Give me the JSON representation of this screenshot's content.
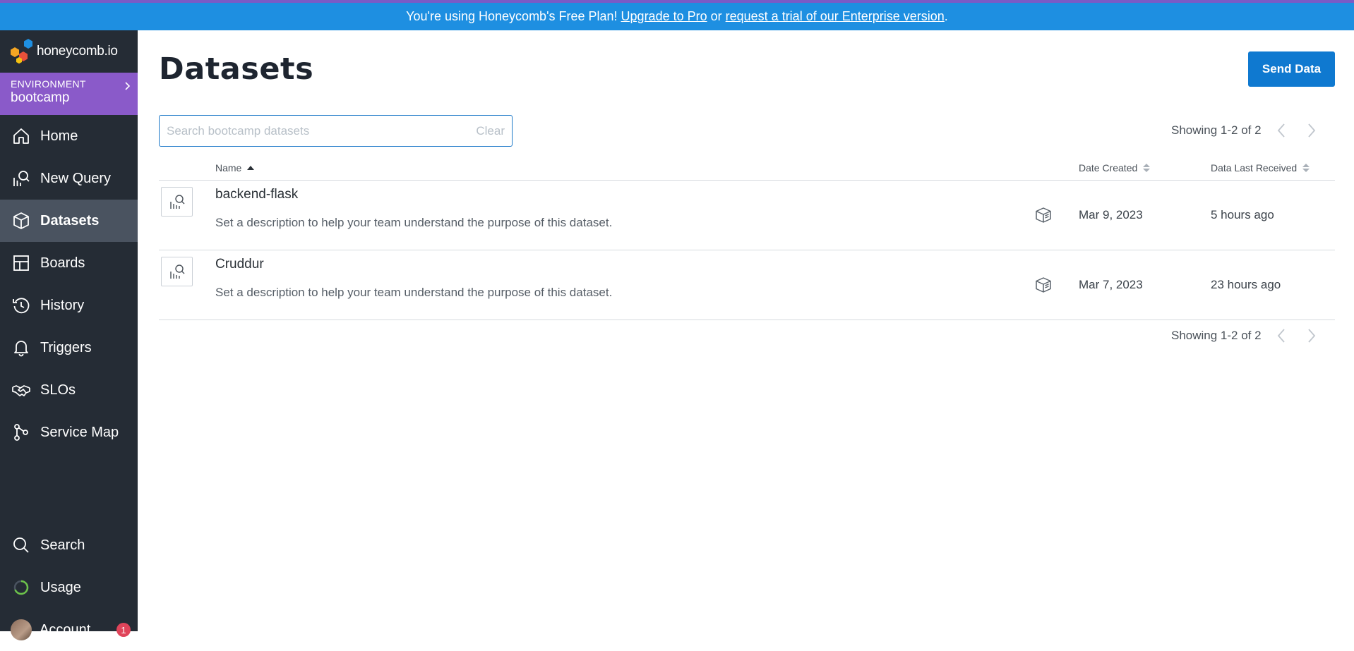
{
  "banner": {
    "prefix": "You're using Honeycomb's Free Plan! ",
    "upgrade_link": "Upgrade to Pro",
    "middle": " or ",
    "trial_link": "request a trial of our Enterprise version",
    "suffix": "."
  },
  "sidebar": {
    "logo_text": "honeycomb.io",
    "environment_label": "ENVIRONMENT",
    "environment_name": "bootcamp",
    "items": [
      {
        "label": "Home",
        "icon": "home-icon"
      },
      {
        "label": "New Query",
        "icon": "new-query-icon"
      },
      {
        "label": "Datasets",
        "icon": "datasets-icon",
        "active": true
      },
      {
        "label": "Boards",
        "icon": "boards-icon"
      },
      {
        "label": "History",
        "icon": "history-icon"
      },
      {
        "label": "Triggers",
        "icon": "bell-icon"
      },
      {
        "label": "SLOs",
        "icon": "handshake-icon"
      },
      {
        "label": "Service Map",
        "icon": "service-map-icon"
      }
    ],
    "bottom_items": [
      {
        "label": "Search",
        "icon": "search-icon"
      },
      {
        "label": "Usage",
        "icon": "usage-icon"
      },
      {
        "label": "Account",
        "icon": "avatar",
        "badge": "1"
      }
    ]
  },
  "main": {
    "title": "Datasets",
    "send_data_label": "Send Data",
    "search": {
      "placeholder": "Search bootcamp datasets",
      "value": "",
      "clear_label": "Clear"
    },
    "pager_text": "Showing 1-2 of 2",
    "columns": {
      "name": "Name",
      "date_created": "Date Created",
      "data_last_received": "Data Last Received"
    },
    "sort": {
      "column": "Name",
      "direction": "ascending"
    },
    "rows": [
      {
        "name": "backend-flask",
        "description": "Set a description to help your team understand the purpose of this dataset.",
        "date_created": "Mar 9, 2023",
        "last_received": "5 hours ago"
      },
      {
        "name": "Cruddur",
        "description": "Set a description to help your team understand the purpose of this dataset.",
        "date_created": "Mar 7, 2023",
        "last_received": "23 hours ago"
      }
    ]
  },
  "colors": {
    "banner_bg": "#1e8fe1",
    "sidebar_bg": "#252c35",
    "environment_bg": "#8a5ac9",
    "active_nav_bg": "#4a5360",
    "primary_button": "#0f79d0",
    "badge": "#e0445a"
  }
}
